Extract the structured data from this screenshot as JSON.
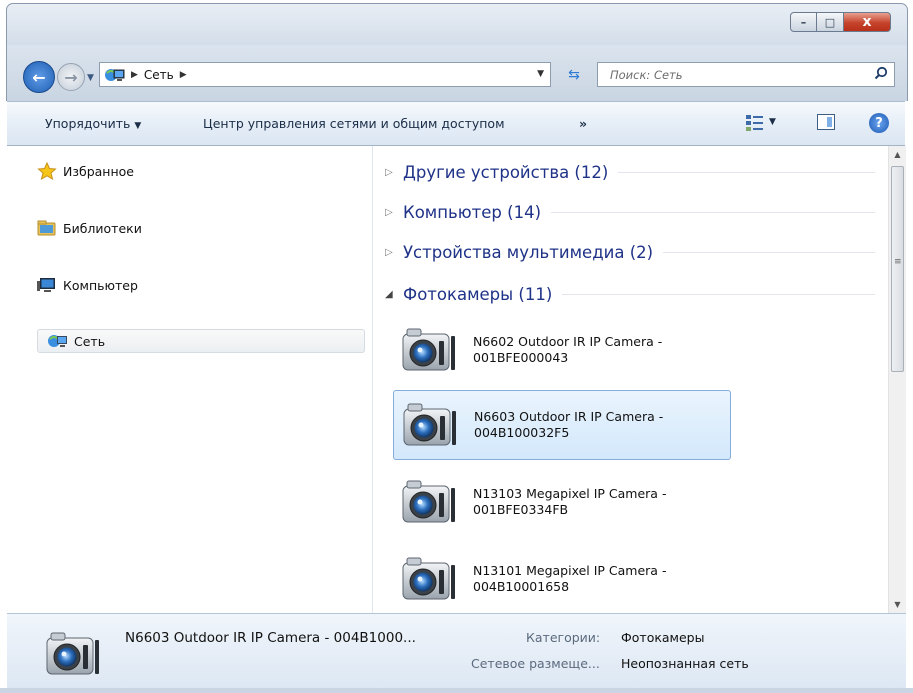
{
  "window": {
    "minimize_label": "–",
    "maximize_label": "□",
    "close_label": "x"
  },
  "address": {
    "breadcrumb": [
      "Сеть"
    ],
    "search_placeholder": "Поиск: Сеть"
  },
  "toolbar": {
    "organize_label": "Упорядочить",
    "network_center_label": "Центр управления сетями и общим доступом",
    "more_label": "»",
    "help_label": "?"
  },
  "nav": {
    "items": [
      {
        "label": "Избранное",
        "icon": "star-icon"
      },
      {
        "label": "Библиотеки",
        "icon": "libraries-icon"
      },
      {
        "label": "Компьютер",
        "icon": "computer-icon"
      },
      {
        "label": "Сеть",
        "icon": "network-icon",
        "selected": true
      }
    ]
  },
  "content": {
    "groups": [
      {
        "label": "Другие устройства (12)",
        "expanded": false
      },
      {
        "label": "Компьютер (14)",
        "expanded": false
      },
      {
        "label": "Устройства мультимедиа (2)",
        "expanded": false
      },
      {
        "label": "Фотокамеры (11)",
        "expanded": true
      }
    ],
    "devices": [
      {
        "line1": "N6602 Outdoor IR IP Camera -",
        "line2": "001BFE000043",
        "selected": false
      },
      {
        "line1": "N6603 Outdoor IR IP Camera -",
        "line2": "004B100032F5",
        "selected": true
      },
      {
        "line1": "N13103 Megapixel IP Camera -",
        "line2": "001BFE0334FB",
        "selected": false
      },
      {
        "line1": "N13101 Megapixel IP Camera -",
        "line2": "004B10001658",
        "selected": false
      }
    ]
  },
  "details": {
    "name": "N6603  Outdoor IR IP Camera - 004B1000...",
    "category_key": "Категории:",
    "category_value": "Фотокамеры",
    "location_key": "Сетевое размеще...",
    "location_value": "Неопознанная сеть"
  },
  "colors": {
    "group_header": "#1e3287",
    "selection_fill": "#d3e8fb",
    "selection_border": "#84acdd",
    "close_button": "#c6432b"
  }
}
